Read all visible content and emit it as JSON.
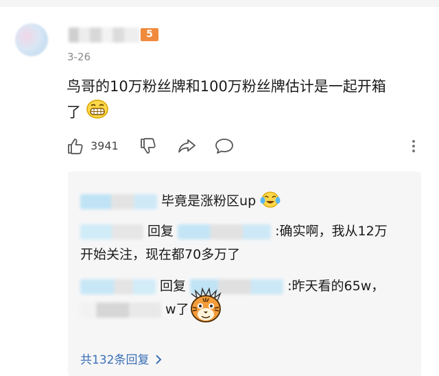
{
  "comment": {
    "level_badge": "5",
    "date": "3-26",
    "text_line1": "鸟哥的10万粉丝牌和100万粉丝牌估计是一起开箱",
    "text_line2": "了",
    "like_count": "3941"
  },
  "icons": {
    "like": "thumbs-up-icon",
    "dislike": "thumbs-down-icon",
    "share": "share-icon",
    "reply": "comment-bubble-icon",
    "more": "more-vertical-icon"
  },
  "replies": [
    {
      "text": "毕竟是涨粉区up"
    },
    {
      "reply_label": "回复",
      "text_line1": ":确实啊，我从12万",
      "text_line2": "开始关注，现在都70多万了"
    },
    {
      "reply_label": "回复",
      "text_line1": ":昨天看的65w，",
      "text_line2": "w了"
    }
  ],
  "more_replies_label": "共132条回复",
  "colors": {
    "badge": "#f08a3c",
    "link": "#3a6fb5",
    "reply_bg": "#f6f6f7"
  }
}
